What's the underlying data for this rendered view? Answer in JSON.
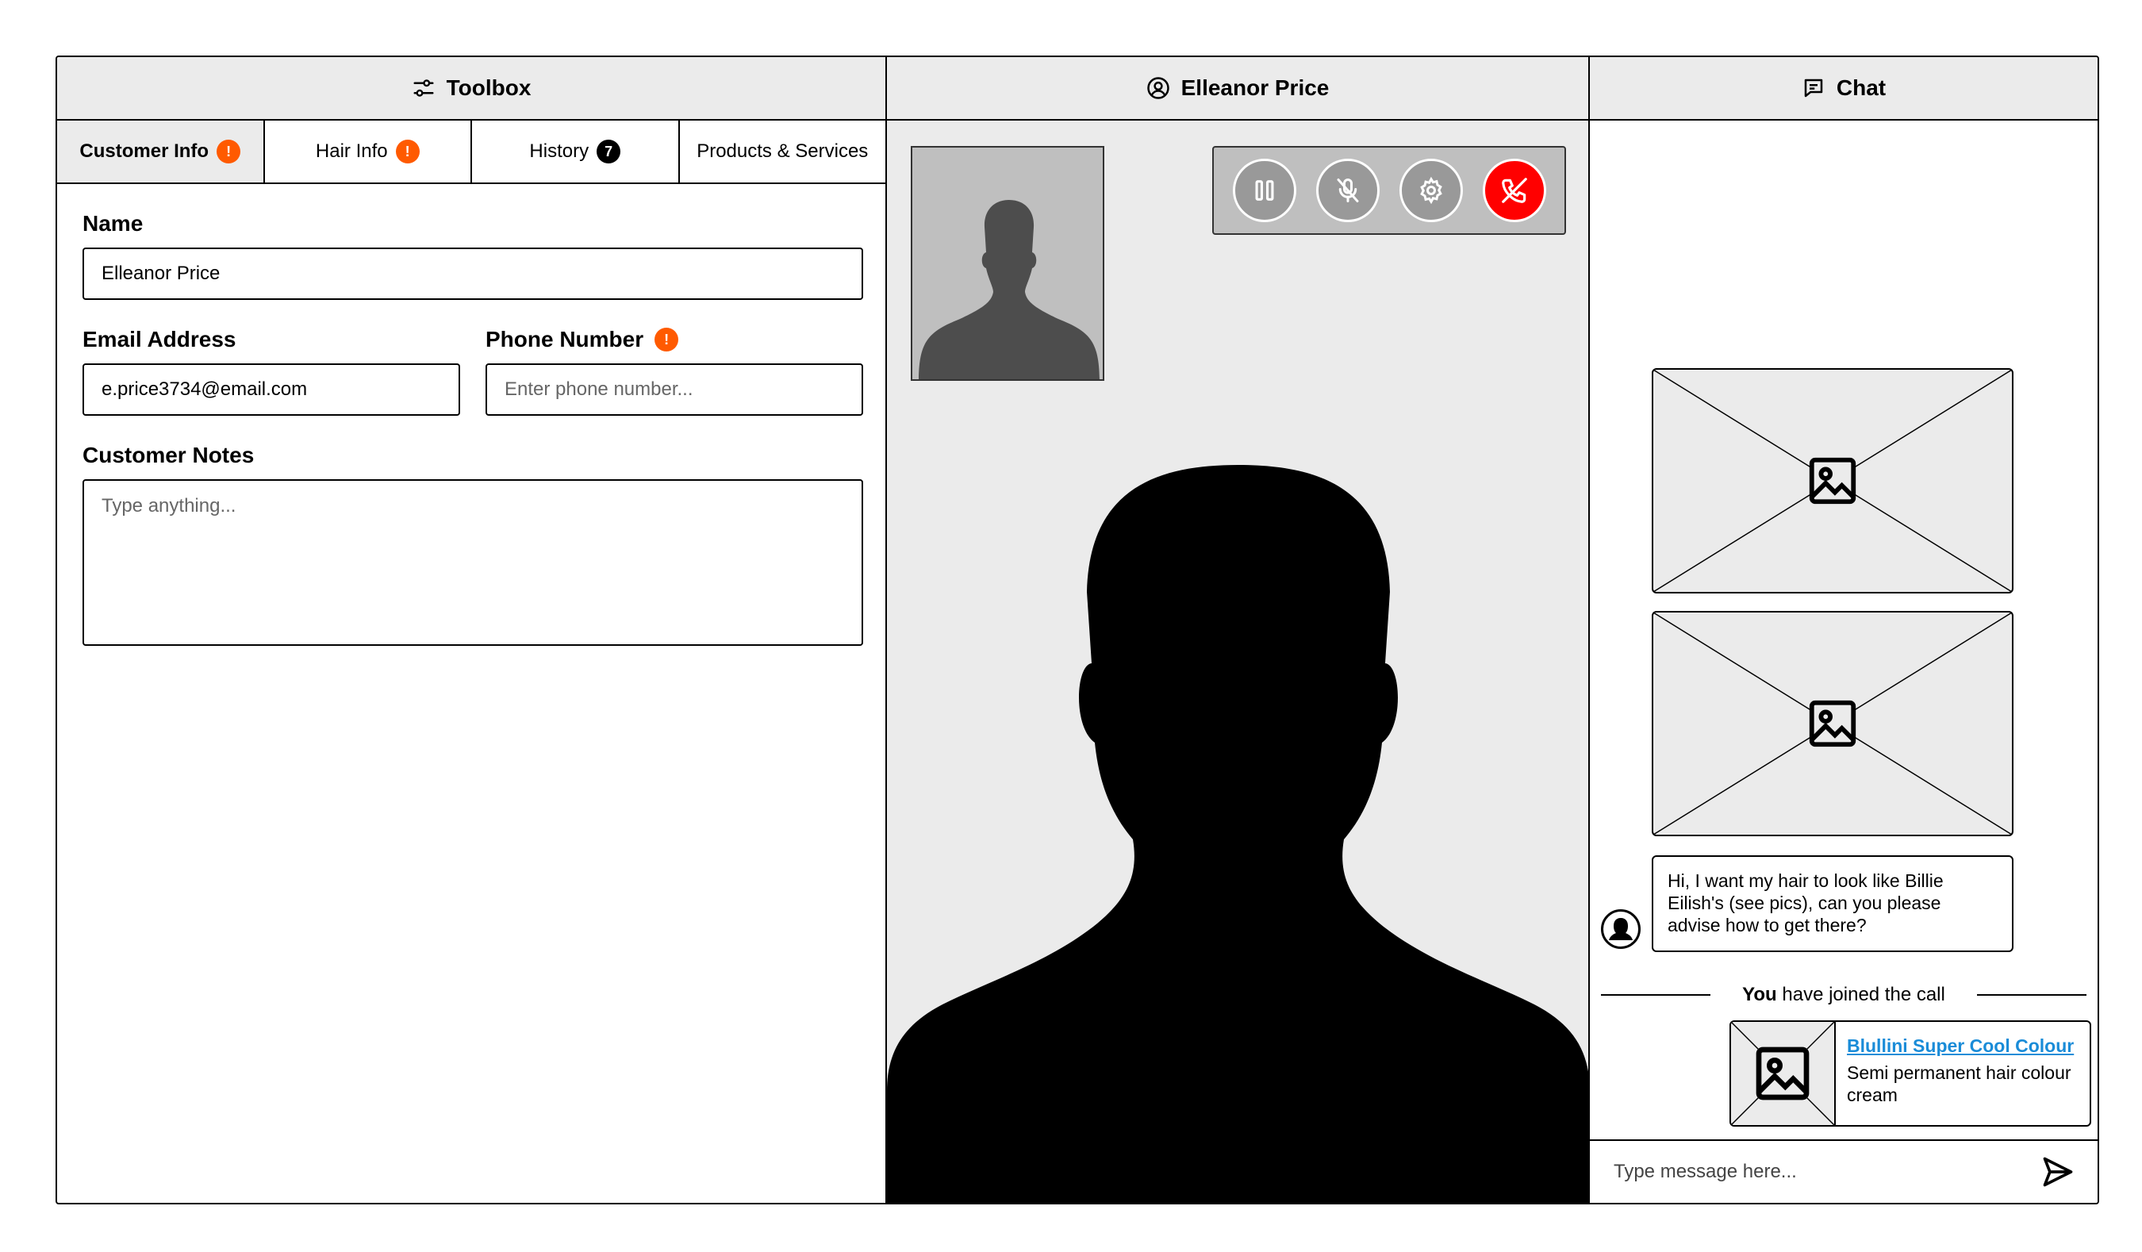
{
  "toolbox": {
    "title": "Toolbox",
    "icon": "sliders-icon",
    "tabs": [
      {
        "label": "Customer Info",
        "badge": "!",
        "active": true
      },
      {
        "label": "Hair Info",
        "badge": "!"
      },
      {
        "label": "History",
        "badge": "7"
      },
      {
        "label": "Products & Services"
      }
    ],
    "form": {
      "name_label": "Name",
      "name_value": "Elleanor Price",
      "email_label": "Email Address",
      "email_value": "e.price3734@email.com",
      "phone_label": "Phone Number",
      "phone_badge": "!",
      "phone_placeholder": "Enter phone number...",
      "notes_label": "Customer Notes",
      "notes_placeholder": "Type anything..."
    }
  },
  "video": {
    "title": "Elleanor Price",
    "icon": "user-circle-icon",
    "controls": [
      "pause-icon",
      "mic-off-icon",
      "gear-icon",
      "end-call-icon"
    ]
  },
  "chat": {
    "title": "Chat",
    "icon": "chat-icon",
    "message_text": "Hi, I want my hair to look like Billie Eilish's (see pics), can you please advise how to get there?",
    "join_you": "You",
    "join_rest": " have joined the call",
    "product": {
      "name": "Blullini Super Cool Colour",
      "description": "Semi permanent hair colour cream"
    },
    "composer_placeholder": "Type message here..."
  },
  "colors": {
    "accent_warning": "#ff5a00",
    "end_call": "#ff0000",
    "link": "#1a8cd8",
    "panel_gray": "#ebebeb"
  }
}
